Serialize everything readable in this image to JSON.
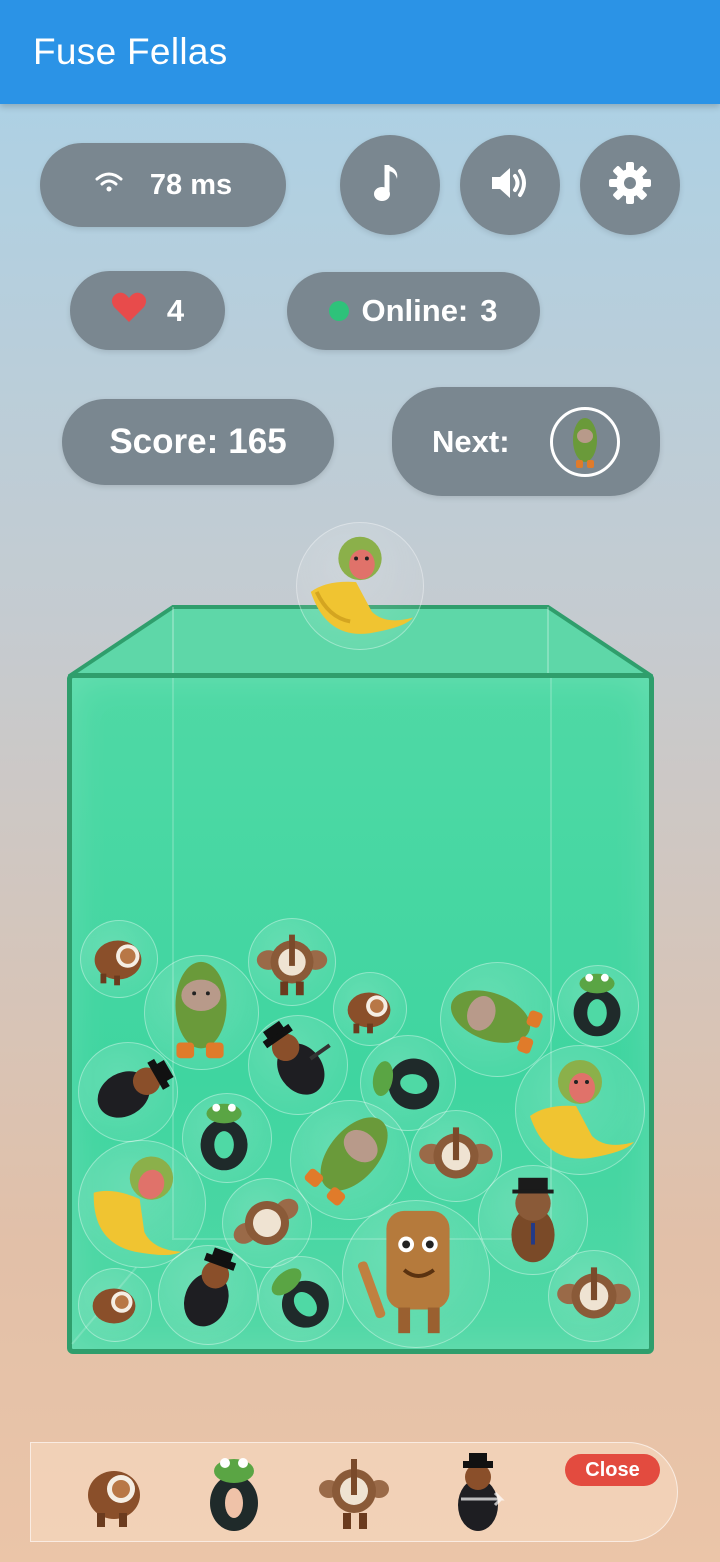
{
  "app": {
    "title": "Fuse Fellas"
  },
  "hud": {
    "ping": "78 ms",
    "lives": "4",
    "online_label": "Online:",
    "online_count": "3",
    "score_label": "Score:",
    "score_value": "165",
    "next_label": "Next:",
    "next_piece": "cactus-hippo"
  },
  "controls": {
    "music_icon": "music-note-icon",
    "sound_icon": "speaker-icon",
    "settings_icon": "gear-icon"
  },
  "current_piece": "monkey-banana",
  "tray": {
    "items": [
      "capybara-coconut",
      "frog-tire",
      "elephant-coconut",
      "gangster-capybara"
    ],
    "close_label": "Close"
  },
  "colors": {
    "appbar": "#2b93e6",
    "pill": "#7a8790",
    "box_green": "#3fd5a0",
    "box_border": "#2f9e6c",
    "online_dot": "#2ec27a",
    "heart": "#e84b4b",
    "close": "#e34b3f"
  }
}
